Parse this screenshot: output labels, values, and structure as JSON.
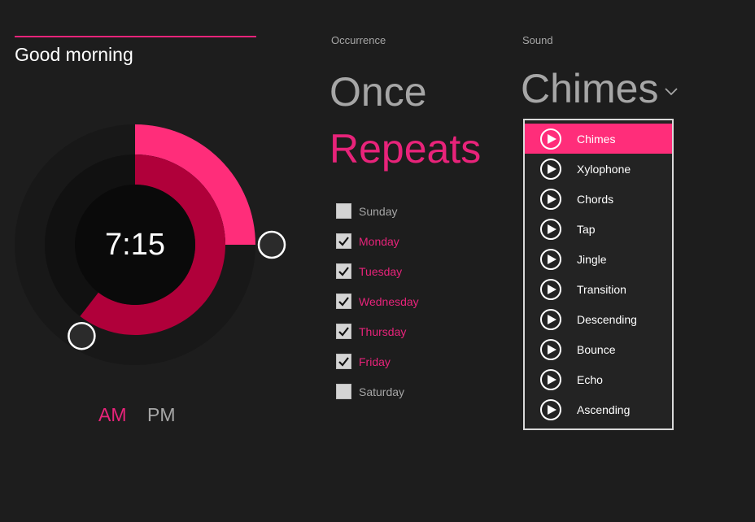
{
  "header": {
    "greeting": "Good morning",
    "accent_color": "#e8237a"
  },
  "clock": {
    "time_display": "7:15",
    "hours": 7,
    "minutes": 15,
    "minute_fraction": 0.25,
    "hour_fraction": 0.6042,
    "period_options": [
      {
        "label": "AM",
        "selected": true
      },
      {
        "label": "PM",
        "selected": false
      }
    ],
    "colors": {
      "minute_arc": "#ff2d7a",
      "hour_arc": "#b0003a",
      "outer_track": "#181818",
      "middle_track": "#111111",
      "inner_face": "#0a0a0a",
      "handle_fill": "#2b2b2b",
      "handle_stroke": "#ffffff"
    }
  },
  "occurrence": {
    "label": "Occurrence",
    "options": [
      {
        "label": "Once",
        "selected": false
      },
      {
        "label": "Repeats",
        "selected": true
      }
    ],
    "days": [
      {
        "label": "Sunday",
        "checked": false
      },
      {
        "label": "Monday",
        "checked": true
      },
      {
        "label": "Tuesday",
        "checked": true
      },
      {
        "label": "Wednesday",
        "checked": true
      },
      {
        "label": "Thursday",
        "checked": true
      },
      {
        "label": "Friday",
        "checked": true
      },
      {
        "label": "Saturday",
        "checked": false
      }
    ]
  },
  "sound": {
    "label": "Sound",
    "selected": "Chimes",
    "dropdown_icon": "chevron-down-icon",
    "item_icon": "play-icon",
    "options": [
      {
        "label": "Chimes",
        "selected": true
      },
      {
        "label": "Xylophone",
        "selected": false
      },
      {
        "label": "Chords",
        "selected": false
      },
      {
        "label": "Tap",
        "selected": false
      },
      {
        "label": "Jingle",
        "selected": false
      },
      {
        "label": "Transition",
        "selected": false
      },
      {
        "label": "Descending",
        "selected": false
      },
      {
        "label": "Bounce",
        "selected": false
      },
      {
        "label": "Echo",
        "selected": false
      },
      {
        "label": "Ascending",
        "selected": false
      }
    ]
  }
}
